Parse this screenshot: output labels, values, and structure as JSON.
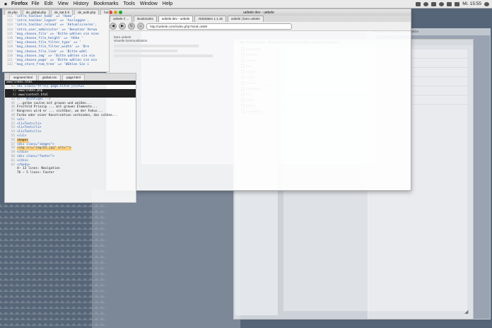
{
  "menubar": {
    "apple": "",
    "app": "Firefox",
    "items": [
      "File",
      "Edit",
      "View",
      "History",
      "Bookmarks",
      "Tools",
      "Window",
      "Help"
    ],
    "clock": "Mi. 15:55"
  },
  "editor": {
    "tabs": [
      "de.php",
      "de_global.php",
      "de_kat.h.tt",
      "de_auth.php",
      "homepage.php"
    ],
    "lines": [
      {
        "n": "111",
        "code": "'intro_toolbar_home' => 'Home',"
      },
      {
        "n": "112",
        "code": "'intro_toolbar_logout' => 'Ausloggen',"
      },
      {
        "n": "113",
        "code": "'intro_toolbar_reload' => 'Aktualisieren',"
      },
      {
        "n": "114",
        "code": "'intro_user_administor' => 'Benutzer Verwa"
      },
      {
        "n": "115",
        "code": "'msg_choose_file' => 'Bitte wählen sie eine"
      },
      {
        "n": "116",
        "code": "'msg_choose_file_height' => 'Höhe '"
      },
      {
        "n": "117",
        "code": "'msg_choose_file_filter_type' => '"
      },
      {
        "n": "118",
        "code": "'msg_choose_file_filter_width' => 'Bre"
      },
      {
        "n": "119",
        "code": "'msg_choose_file_link' => 'Bitte wähl"
      },
      {
        "n": "120",
        "code": "'msg_choose_img' => 'Bitte wählen sie ein"
      },
      {
        "n": "121",
        "code": "'msg_choose_page' => 'Bitte wählen sie ein"
      },
      {
        "n": "122",
        "code": "'msg_store_from_tree' => 'Wählen Sie i"
      }
    ]
  },
  "editor2": {
    "tabs": [
      "segment.html",
      "global.css",
      "page.html"
    ],
    "path_bar": "www/index.html",
    "lines": [
      {
        "n": "41",
        "code": "<h1 class=\"tt\">{{ page.title }}</h1>"
      },
      {
        "n": "42",
        "code": "www/index.php"
      },
      {
        "n": "43",
        "code": "www/content.html"
      },
      {
        "n": "44",
        "code": "<!-- Wichtiges -->"
      },
      {
        "n": "45",
        "code": "...gelbe saulen mit grauen und weißen..."
      },
      {
        "n": "46",
        "code": "Freifeld Prinzip ... mit grauen Elemente..."
      },
      {
        "n": "47",
        "code": "Kongress wird er ... sichtbar, wo der Fokus..."
      },
      {
        "n": "48",
        "code": "Farbe oder einer Konstruktion verbinden, das schöne..."
      },
      {
        "n": "51",
        "code": "<ul>"
      },
      {
        "n": "52",
        "code": "<li>Text</li>"
      },
      {
        "n": "53",
        "code": "<li>Text</li>"
      },
      {
        "n": "54",
        "code": "<li>Text</li>"
      },
      {
        "n": "55",
        "code": "</ul>"
      },
      {
        "n": "56",
        "code": "images"
      },
      {
        "n": "57",
        "code": "<div class=\"images\">"
      },
      {
        "n": "58",
        "code": "<img src=\"img/01.jpg\" alt=\"\">"
      },
      {
        "n": "59",
        "code": "</div>"
      },
      {
        "n": "60",
        "code": "<div class=\"footer\">"
      },
      {
        "n": "61",
        "code": "</div>"
      },
      {
        "n": "62",
        "code": "</body>"
      }
    ],
    "status1": "4— 13 lines: Navigation",
    "status2": "76 — 5 lines: Footer"
  },
  "browser": {
    "window_title": "uebele dev - uebele",
    "tabs": [
      {
        "label": "uebele // ...",
        "active": false
      },
      {
        "label": "Bookmarks",
        "active": false
      },
      {
        "label": "uebele dev - uebele",
        "active": true
      },
      {
        "label": "Aktivitäten 1.1.15",
        "active": false
      },
      {
        "label": "uebele | büro uebele",
        "active": false
      }
    ],
    "url": "http://uebele.com/index.php?Seid=1669",
    "body_lines": [
      "büro uebele",
      "visuelle kommunikation"
    ]
  },
  "app": {
    "title": "http://ms.tlepages.../framework/interface.php?lan=de&area=pagelist...",
    "sidebar_items": [
      "Hauptseite",
      "Projekte",
      "Aktuell",
      "Büro",
      "Kontakt",
      "Archiv",
      "Presse",
      "Impressum",
      "Neu",
      "Team",
      "Bücher",
      "Ausstellung"
    ]
  },
  "far_window": {
    "title": "Redaktion uebele - interaktiv"
  },
  "colors": {
    "desktop": "#566578",
    "highlight": "#f7c97a"
  }
}
